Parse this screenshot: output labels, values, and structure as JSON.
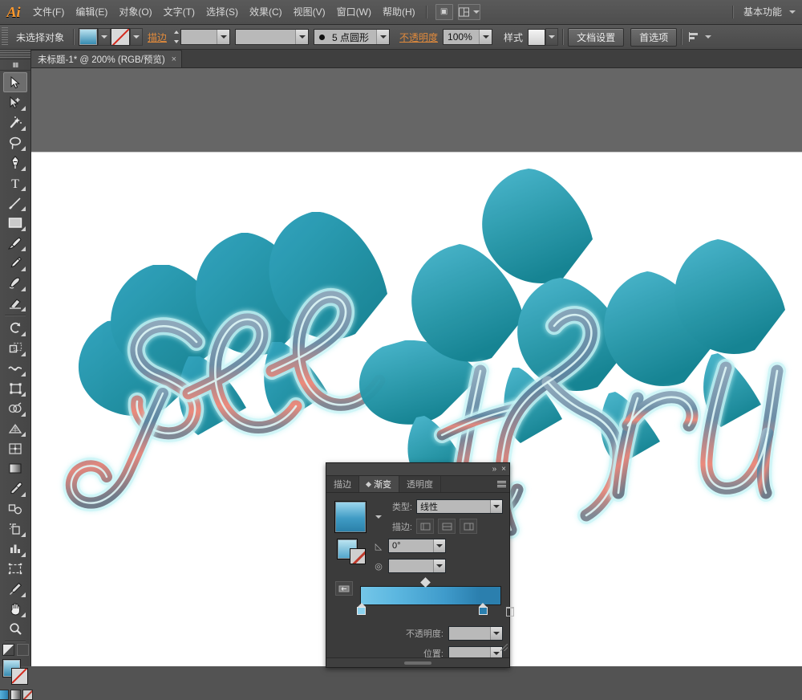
{
  "app": {
    "logo": "Ai",
    "workspace_label": "基本功能"
  },
  "menubar": {
    "items": [
      {
        "label": "文件(F)"
      },
      {
        "label": "编辑(E)"
      },
      {
        "label": "对象(O)"
      },
      {
        "label": "文字(T)"
      },
      {
        "label": "选择(S)"
      },
      {
        "label": "效果(C)"
      },
      {
        "label": "视图(V)"
      },
      {
        "label": "窗口(W)"
      },
      {
        "label": "帮助(H)"
      }
    ],
    "bridge_icon": "bridge-icon",
    "arrange_icon": "arrange-documents-icon"
  },
  "controlbar": {
    "selection_status": "未选择对象",
    "fill_swatch": "gradient-blue",
    "stroke_swatch": "none",
    "stroke_label": "描边",
    "stroke_weight_value": "",
    "stroke_weight_placeholder": "",
    "stroke_profile_value": "",
    "brush_def_value": "5 点圆形",
    "opacity_label": "不透明度",
    "opacity_value": "100%",
    "style_label": "样式",
    "document_setup_label": "文档设置",
    "preferences_label": "首选项",
    "align_icon": "align-icon"
  },
  "document": {
    "tab_title": "未标题-1* @ 200% (RGB/预览)",
    "close_glyph": "×"
  },
  "toolbar": {
    "tools": [
      {
        "name": "selection-tool",
        "selected": true
      },
      {
        "name": "direct-selection-tool",
        "selected": false
      },
      {
        "name": "magic-wand-tool",
        "selected": false
      },
      {
        "name": "lasso-tool",
        "selected": false
      },
      {
        "name": "pen-tool",
        "selected": false
      },
      {
        "name": "type-tool",
        "selected": false
      },
      {
        "name": "line-segment-tool",
        "selected": false
      },
      {
        "name": "rectangle-tool",
        "selected": false
      },
      {
        "name": "paintbrush-tool",
        "selected": false
      },
      {
        "name": "pencil-tool",
        "selected": false
      },
      {
        "name": "blob-brush-tool",
        "selected": false
      },
      {
        "name": "eraser-tool",
        "selected": false
      },
      {
        "name": "rotate-tool",
        "selected": false
      },
      {
        "name": "scale-tool",
        "selected": false
      },
      {
        "name": "width-tool",
        "selected": false
      },
      {
        "name": "free-transform-tool",
        "selected": false
      },
      {
        "name": "shape-builder-tool",
        "selected": false
      },
      {
        "name": "perspective-grid-tool",
        "selected": false
      },
      {
        "name": "mesh-tool",
        "selected": false
      },
      {
        "name": "gradient-tool",
        "selected": false
      },
      {
        "name": "eyedropper-tool",
        "selected": false
      },
      {
        "name": "blend-tool",
        "selected": false
      },
      {
        "name": "symbol-sprayer-tool",
        "selected": false
      },
      {
        "name": "column-graph-tool",
        "selected": false
      },
      {
        "name": "artboard-tool",
        "selected": false
      },
      {
        "name": "slice-tool",
        "selected": false
      },
      {
        "name": "hand-tool",
        "selected": false
      },
      {
        "name": "zoom-tool",
        "selected": false
      }
    ],
    "fill_color": "#3f9bc4",
    "stroke_color": "none"
  },
  "artwork": {
    "text_words": [
      "see",
      "thru"
    ],
    "colors": {
      "teal_light": "#3aa8c4",
      "teal_mid": "#2896b4",
      "teal_dark": "#1f8fa6",
      "teal_deep": "#15808f",
      "teal_shadow": "#0e7b80",
      "highlight": "#bdf0f2",
      "accent_salmon": "#e8877e",
      "accent_gray": "#7d8796",
      "accent_slate": "#5f7a8c",
      "background": "#ffffff"
    }
  },
  "gradient_panel": {
    "title_collapse": "»",
    "title_close": "×",
    "tabs": [
      {
        "label": "描边",
        "active": false
      },
      {
        "label": "渐变",
        "active": true
      },
      {
        "label": "透明度",
        "active": false
      }
    ],
    "type_label": "类型:",
    "type_value": "线性",
    "stroke_label": "描边:",
    "angle_value": "0°",
    "aspect_value": "",
    "opacity_label": "不透明度:",
    "opacity_value": "",
    "location_label": "位置:",
    "location_value": "",
    "gradient_stops": [
      {
        "position": 0,
        "color": "#7cc9ea"
      },
      {
        "position": 85,
        "color": "#2b7fae"
      }
    ],
    "gradient_midpoint": 45
  }
}
